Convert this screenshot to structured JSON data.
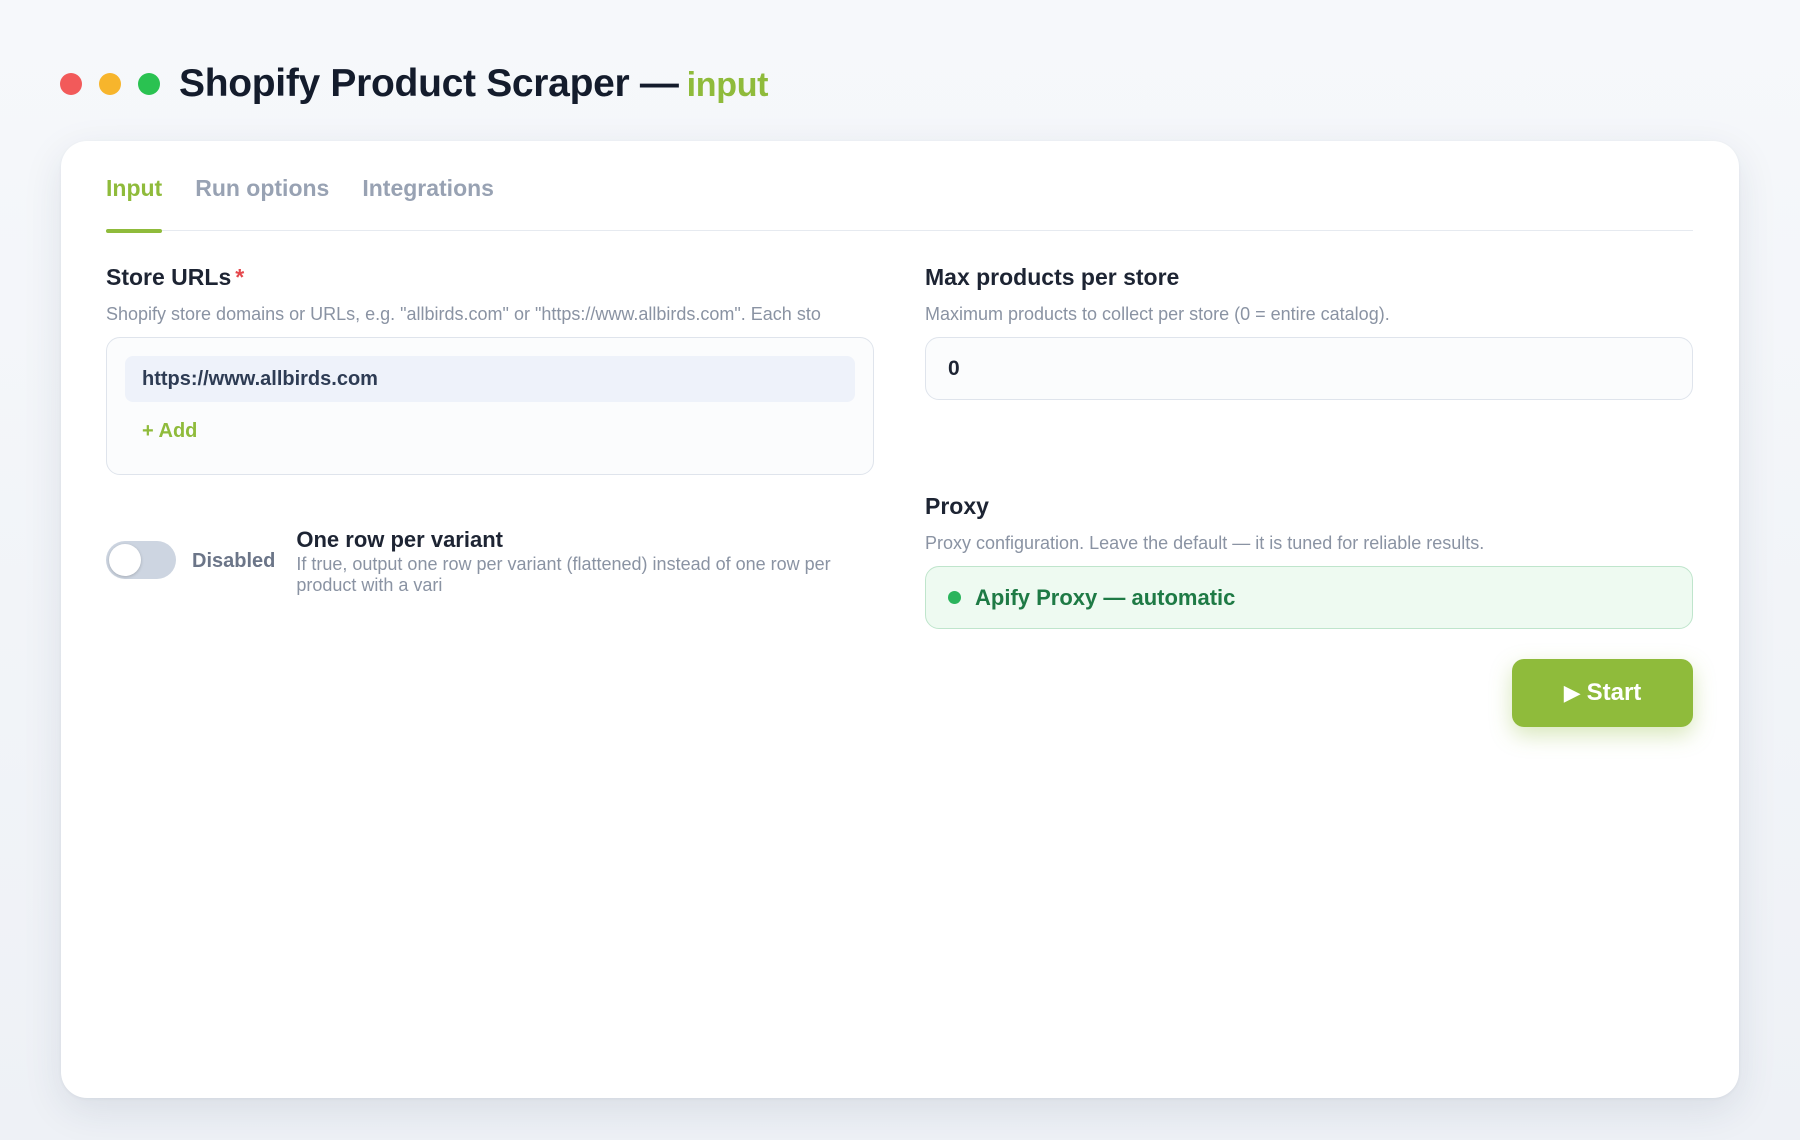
{
  "window": {
    "title": "Shopify Product Scraper —",
    "subtitle": "input",
    "controls": {
      "close_color": "#f25a5a",
      "minimize_color": "#f7b52c",
      "maximize_color": "#2ac251"
    }
  },
  "tabs": [
    {
      "label": "Input",
      "active": true
    },
    {
      "label": "Run options",
      "active": false
    },
    {
      "label": "Integrations",
      "active": false
    }
  ],
  "store_urls": {
    "label": "Store URLs",
    "required_marker": "*",
    "description": "Shopify store domains or URLs, e.g. \"allbirds.com\" or \"https://www.allbirds.com\". Each sto",
    "items": [
      "https://www.allbirds.com"
    ],
    "add_label": "+ Add"
  },
  "max_products": {
    "label": "Max products per store",
    "description": "Maximum products to collect per store (0 = entire catalog).",
    "value": "0"
  },
  "variant_toggle": {
    "enabled": false,
    "state_label": "Disabled",
    "title": "One row per variant",
    "description": "If true, output one row per variant (flattened) instead of one row per product with a vari"
  },
  "proxy": {
    "label": "Proxy",
    "description": "Proxy configuration. Leave the default — it is tuned for reliable results.",
    "value": "Apify Proxy — automatic",
    "status_color": "#2ab45c"
  },
  "start_button": {
    "icon": "play-icon",
    "label": "Start"
  },
  "colors": {
    "accent": "#8fbb3b",
    "required": "#e5484d",
    "proxy_text": "#1e7a45"
  }
}
